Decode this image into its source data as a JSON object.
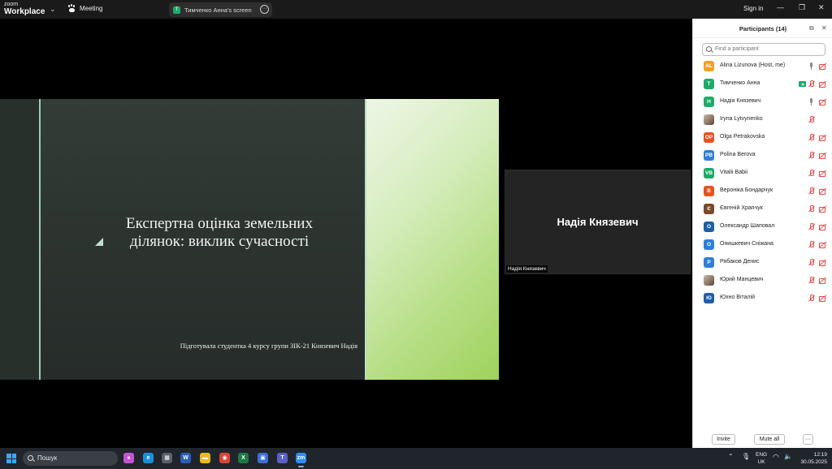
{
  "window": {
    "logo_line1": "zoom",
    "logo_line2": "Workplace",
    "meeting_label": "Meeting",
    "share_label": "Тимченко Анна's screen",
    "share_icon_letter": "Т",
    "more_glyph": "···",
    "signin_label": "Sign in",
    "minimize_glyph": "—",
    "restore_glyph": "❐",
    "close_glyph": "✕"
  },
  "slide": {
    "title_line1": "Експертна оцінка земельних",
    "title_line2": "ділянок: виклик сучасності",
    "subtitle": "Підготувала студентка 4 курсу групи ЗІК-21 Князевич Надія"
  },
  "video_tile": {
    "display_name": "Надія Князевич",
    "label": "Надія Князевич"
  },
  "participants": {
    "title": "Participants (14)",
    "search_placeholder": "Find a participant",
    "list": [
      {
        "initials": "AL",
        "name": "Alina Lizunova (Host, me)",
        "color": "#f0a12a",
        "audio": "on",
        "video": "off"
      },
      {
        "initials": "Т",
        "name": "Тимченко Анна",
        "color": "#1eaa6a",
        "audio": "off",
        "video": "off",
        "sharing": true
      },
      {
        "initials": "Н",
        "name": "Надія Князевич",
        "color": "#1eaa6a",
        "audio": "on",
        "video": "off"
      },
      {
        "initials": "",
        "name": "Iryna Lytvynenko",
        "color": "photo",
        "audio": "off",
        "video": "none"
      },
      {
        "initials": "OP",
        "name": "Olga Petrakovska",
        "color": "#e6531f",
        "audio": "off",
        "video": "off"
      },
      {
        "initials": "PB",
        "name": "Polina Berova",
        "color": "#2f7fd8",
        "audio": "off",
        "video": "off"
      },
      {
        "initials": "VB",
        "name": "Vitalii Babii",
        "color": "#1eaa6a",
        "audio": "off",
        "video": "off"
      },
      {
        "initials": "В",
        "name": "Вероніка Бондарчук",
        "color": "#e6531f",
        "audio": "off",
        "video": "off"
      },
      {
        "initials": "Є",
        "name": "Євгеній Храпчук",
        "color": "#7a4a2a",
        "audio": "off",
        "video": "off"
      },
      {
        "initials": "О",
        "name": "Олександр Шаповал",
        "color": "#1f5fa8",
        "audio": "off",
        "video": "off"
      },
      {
        "initials": "О",
        "name": "Онишкевич Сніжана",
        "color": "#2f7fd8",
        "audio": "off",
        "video": "off"
      },
      {
        "initials": "Р",
        "name": "Рябаков Денис",
        "color": "#2f7fd8",
        "audio": "off",
        "video": "off"
      },
      {
        "initials": "",
        "name": "Юрий Манцевич",
        "color": "photo",
        "audio": "off",
        "video": "off"
      },
      {
        "initials": "Ю",
        "name": "Юхно Віталій",
        "color": "#1f5fa8",
        "audio": "off",
        "video": "off"
      }
    ],
    "invite_label": "Invite",
    "mute_all_label": "Mute all",
    "more_label": "···"
  },
  "taskbar": {
    "search_placeholder": "Пошук",
    "apps": [
      {
        "name": "copilot",
        "glyph": "●",
        "color": "#c454d6"
      },
      {
        "name": "edge",
        "glyph": "e",
        "color": "#1a8fd8"
      },
      {
        "name": "calculator",
        "glyph": "▦",
        "color": "#59606b"
      },
      {
        "name": "word",
        "glyph": "W",
        "color": "#2b5eb8"
      },
      {
        "name": "explorer",
        "glyph": "▬",
        "color": "#e8b82a"
      },
      {
        "name": "chrome",
        "glyph": "◉",
        "color": "#d9443a"
      },
      {
        "name": "excel",
        "glyph": "X",
        "color": "#1f7a45"
      },
      {
        "name": "store",
        "glyph": "▣",
        "color": "#3a6fd8"
      },
      {
        "name": "teams",
        "glyph": "T",
        "color": "#5b5fc7"
      },
      {
        "name": "zoom",
        "glyph": "zm",
        "color": "#2d8cff",
        "active": true
      }
    ],
    "lang_line1": "ENG",
    "lang_line2": "UK",
    "time": "12:19",
    "date": "30.05.2025"
  }
}
